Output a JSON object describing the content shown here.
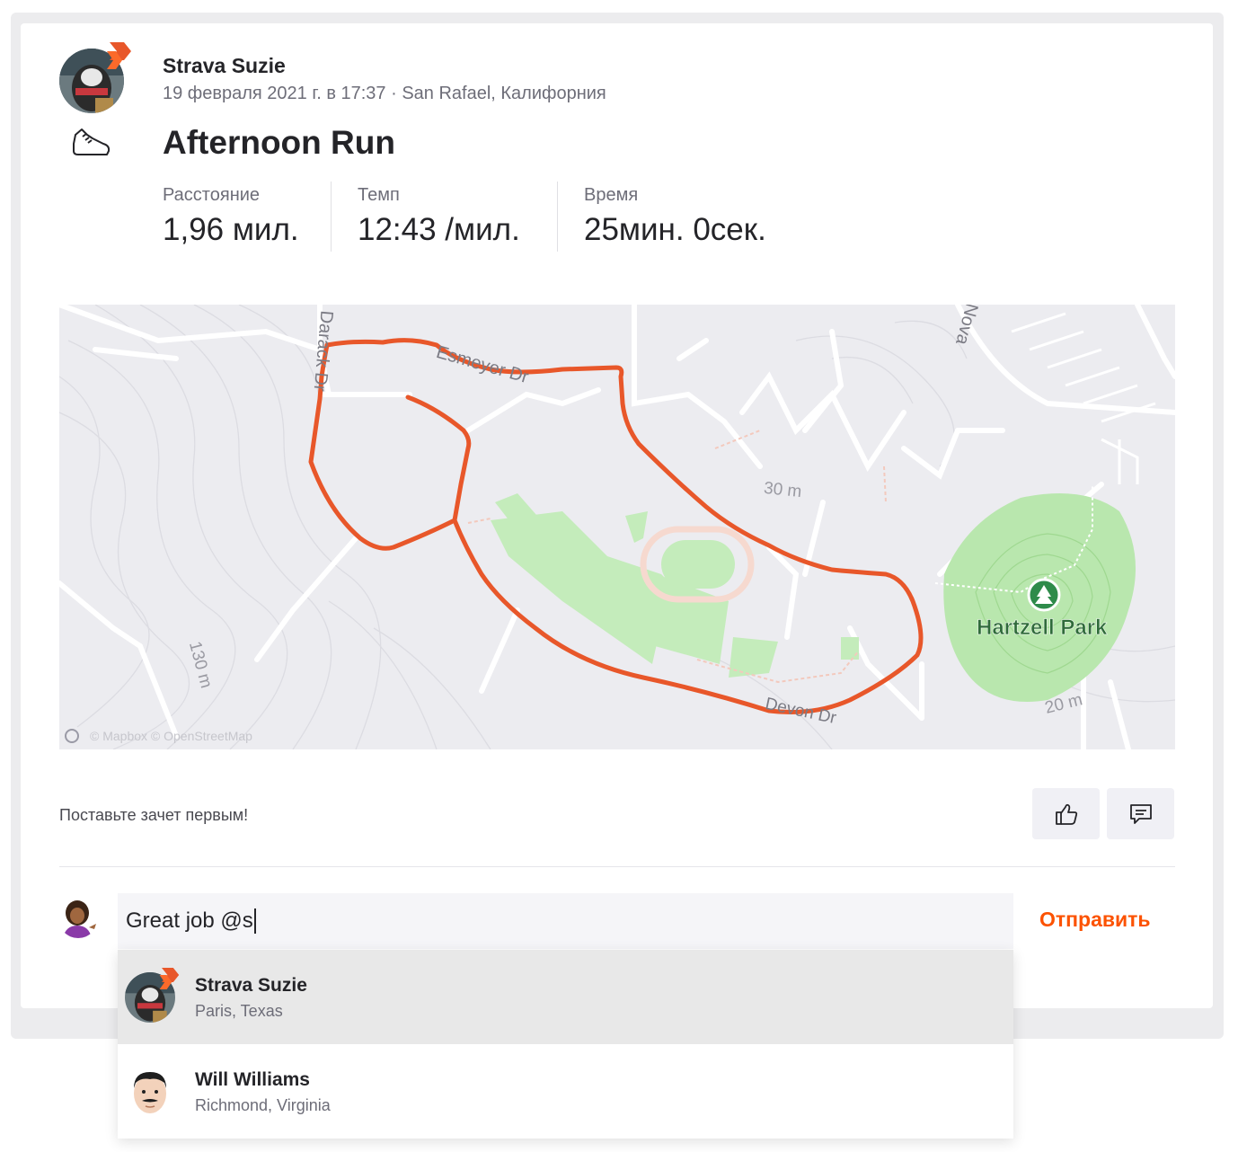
{
  "activity": {
    "athlete_name": "Strava Suzie",
    "meta": "19 февраля 2021 г. в 17:37 · San Rafael, Калифорния",
    "title": "Afternoon Run",
    "activity_type_icon": "running-shoe-icon",
    "stats": [
      {
        "label": "Расстояние",
        "value": "1,96 мил."
      },
      {
        "label": "Темп",
        "value": "12:43 /мил."
      },
      {
        "label": "Время",
        "value": "25мин. 0сек."
      }
    ]
  },
  "map": {
    "park_label": "Hartzell Park",
    "elevation_labels": [
      "30 m",
      "130 m",
      "20 m"
    ],
    "street_labels": [
      "Esmeyer Dr",
      "Darack Dr",
      "Devon Dr",
      "Nova"
    ],
    "attribution": "© Mapbox © OpenStreetMap",
    "route_color": "#e8572a",
    "park_color": "#b9e7ae"
  },
  "kudos": {
    "text": "Поставьте зачет первым!",
    "kudos_icon": "thumbs-up-icon",
    "comment_icon": "comment-icon"
  },
  "comment": {
    "input_value": "Great job @s",
    "send_label": "Отправить"
  },
  "mentions": [
    {
      "name": "Strava Suzie",
      "location": "Paris, Texas",
      "selected": true
    },
    {
      "name": "Will Williams",
      "location": "Richmond, Virginia",
      "selected": false
    }
  ],
  "colors": {
    "accent": "#fc5200",
    "text": "#242428",
    "muted": "#6d6d78"
  }
}
